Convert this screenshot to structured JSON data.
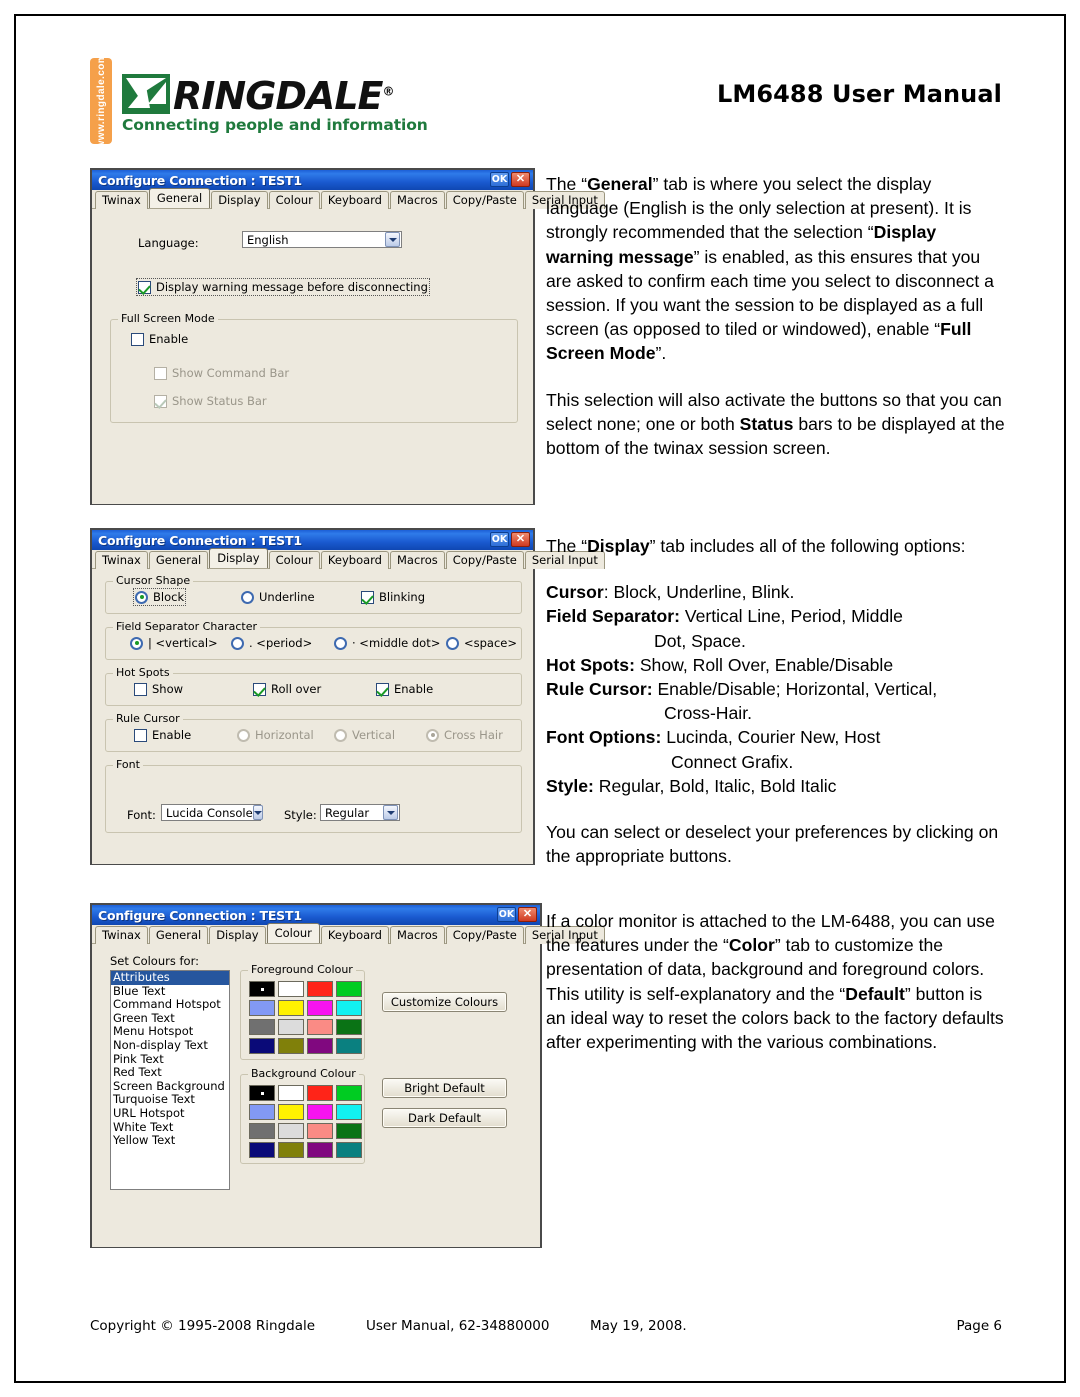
{
  "header": {
    "logo_vertical_text": "www.ringdale.com",
    "brand": "RINGDALE",
    "brand_reg": "®",
    "tagline": "Connecting people and information",
    "manual_title": "LM6488 User Manual"
  },
  "dialogs": {
    "general": {
      "title": "Configure Connection : TEST1",
      "ok_label": "OK",
      "close_label": "✕",
      "tabs": [
        "Twinax",
        "General",
        "Display",
        "Colour",
        "Keyboard",
        "Macros",
        "Copy/Paste",
        "Serial Input"
      ],
      "active_tab": "General",
      "language_label": "Language:",
      "language_value": "English",
      "warning_checkbox_label": "Display warning message before disconnecting",
      "warning_checked": true,
      "fullscreen_group": "Full Screen Mode",
      "enable_label": "Enable",
      "show_command_bar_label": "Show Command Bar",
      "show_status_bar_label": "Show Status Bar"
    },
    "display": {
      "title": "Configure Connection : TEST1",
      "ok_label": "OK",
      "close_label": "✕",
      "tabs": [
        "Twinax",
        "General",
        "Display",
        "Colour",
        "Keyboard",
        "Macros",
        "Copy/Paste",
        "Serial Input"
      ],
      "active_tab": "Display",
      "cursor_group": "Cursor Shape",
      "cursor_block": "Block",
      "cursor_underline": "Underline",
      "cursor_blinking": "Blinking",
      "fieldsep_group": "Field Separator Character",
      "fieldsep_vertical": "|  <vertical>",
      "fieldsep_period": ".  <period>",
      "fieldsep_middledot": "·  <middle dot>",
      "fieldsep_space": "<space>",
      "hotspots_group": "Hot Spots",
      "hotspots_show": "Show",
      "hotspots_rollover": "Roll over",
      "hotspots_enable": "Enable",
      "rulecursor_group": "Rule Cursor",
      "rulecursor_enable": "Enable",
      "rulecursor_horizontal": "Horizontal",
      "rulecursor_vertical": "Vertical",
      "rulecursor_crosshair": "Cross Hair",
      "font_group": "Font",
      "font_label": "Font:",
      "font_value": "Lucida Console",
      "style_label": "Style:",
      "style_value": "Regular"
    },
    "colour": {
      "title": "Configure Connection : TEST1",
      "ok_label": "OK",
      "close_label": "✕",
      "tabs": [
        "Twinax",
        "General",
        "Display",
        "Colour",
        "Keyboard",
        "Macros",
        "Copy/Paste",
        "Serial Input"
      ],
      "active_tab": "Colour",
      "set_colours_label": "Set Colours for:",
      "list_items": [
        "Attributes",
        "Blue Text",
        "Command Hotspot",
        "Green Text",
        "Menu Hotspot",
        "Non-display Text",
        "Pink Text",
        "Red Text",
        "Screen Background",
        "Turquoise Text",
        "URL Hotspot",
        "White Text",
        "Yellow Text"
      ],
      "selected_item": "Attributes",
      "foreground_group": "Foreground Colour",
      "background_group": "Background Colour",
      "palette": [
        "#000000",
        "#FFFFFF",
        "#FF2418",
        "#00CC22",
        "#8299F4",
        "#FFF200",
        "#F713F0",
        "#12F1F1",
        "#707070",
        "#DCDCDC",
        "#FA8B85",
        "#0A7315",
        "#0A0A78",
        "#80800A",
        "#80087F",
        "#0A8080"
      ],
      "foreground_selected_index": 0,
      "background_selected_index": 0,
      "customize_button": "Customize Colours",
      "bright_default_button": "Bright Default",
      "dark_default_button": "Dark Default"
    }
  },
  "text": {
    "p1_part1": "The “",
    "p1_b1": "General",
    "p1_part2": "” tab is where you select the display language (English is the only selection at present).  It is strongly recommended that the selection “",
    "p1_b2": "Display warning message",
    "p1_part3": "” is enabled, as this ensures that you are asked to confirm each time you select to disconnect a session.  If you want the session to be displayed as a full screen (as opposed to tiled or windowed), enable “",
    "p1_b3": "Full Screen Mode",
    "p1_part4": "”.",
    "p2_part1": "This selection will also activate the buttons so that you can select none; one or both ",
    "p2_b1": "Status",
    "p2_part2": " bars to be displayed at the bottom of the twinax session screen.",
    "p3_part1": "The “",
    "p3_b1": "Display",
    "p3_part2": "” tab includes all of the following options:",
    "opt_cursor_label": "Cursor",
    "opt_cursor_value": ":  Block, Underline, Blink.",
    "opt_fieldsep_label": "Field Separator:",
    "opt_fieldsep_value": "  Vertical Line, Period, Middle",
    "opt_fieldsep_cont": "Dot, Space.",
    "opt_hotspots_label": "Hot Spots:",
    "opt_hotspots_value": "  Show, Roll Over, Enable/Disable",
    "opt_rulecursor_label": "Rule Cursor:",
    "opt_rulecursor_value": "  Enable/Disable; Horizontal, Vertical,",
    "opt_rulecursor_cont": "Cross-Hair.",
    "opt_font_label": "Font Options:",
    "opt_font_value": "  Lucinda, Courier New, Host",
    "opt_font_cont": "Connect Grafix.",
    "opt_style_label": "Style:",
    "opt_style_value": "  Regular, Bold, Italic, Bold Italic",
    "p4": "You can select or deselect your preferences by clicking on the appropriate buttons.",
    "p5_part1": "If a color monitor is attached to the LM-6488, you can use the features under the “",
    "p5_b1": "Color",
    "p5_part2": "” tab to customize the presentation of data, background and foreground colors.  This utility is self-explanatory and the “",
    "p5_b2": "Default",
    "p5_part3": "” button is an ideal way to reset the colors back to the factory defaults after experimenting with the various combinations."
  },
  "footer": {
    "copyright": "Copyright © 1995-2008 Ringdale",
    "manual": "User Manual, 62-34880000",
    "date": "May 19, 2008.",
    "page": "Page 6"
  }
}
